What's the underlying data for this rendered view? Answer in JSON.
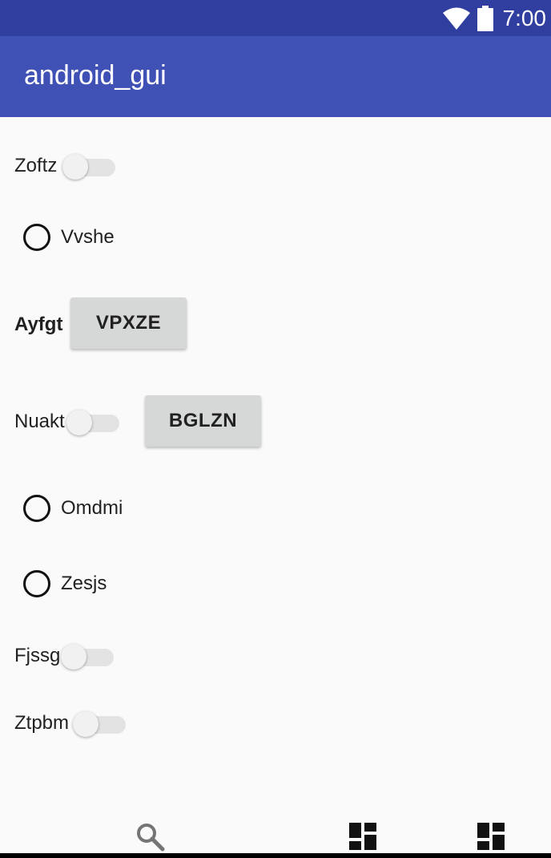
{
  "status_bar": {
    "time": "7:00",
    "icons": [
      "wifi-icon",
      "battery-icon"
    ]
  },
  "app_bar": {
    "title": "android_gui"
  },
  "rows": {
    "zoftz_label": "Zoftz",
    "vvshe_label": "Vvshe",
    "ayfgt_label": "Ayfgt",
    "vpxze_button": "VPXZE",
    "nuakt_label": "Nuakt",
    "bglzn_button": "BGLZN",
    "omdmi_label": "Omdmi",
    "zesjs_label": "Zesjs",
    "fjssg_label": "Fjssg",
    "ztpbm_label": "Ztpbm"
  },
  "bottom_nav": {
    "icons": [
      "search-icon",
      "dashboard-icon",
      "dashboard-icon"
    ]
  },
  "colors": {
    "status_bar": "#303f9f",
    "app_bar": "#3f51b5",
    "background": "#fafafa",
    "button": "#d6d7d7"
  }
}
